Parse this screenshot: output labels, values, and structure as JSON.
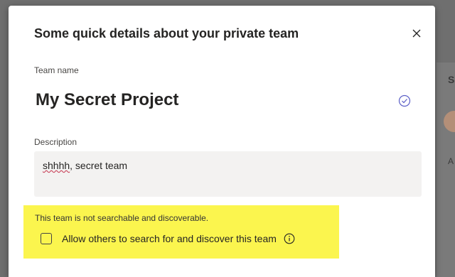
{
  "background": {
    "partial_heading": "S",
    "partial_text": "A"
  },
  "dialog": {
    "title": "Some quick details about your private team",
    "close_icon": "close-icon",
    "team_name_label": "Team name",
    "team_name_value": "My Secret Project",
    "team_name_status_icon": "check-circle-icon",
    "description_label": "Description",
    "description_value_word1": "shhhh",
    "description_value_rest": ", secret team",
    "searchability_note": "This team is not searchable and discoverable.",
    "discover_option": {
      "label": "Allow others to search for and discover this team",
      "checked": false,
      "info_icon": "info-icon"
    }
  },
  "colors": {
    "highlight": "#fbf54e",
    "dialog_bg": "#ffffff",
    "input_bg": "#f3f2f1",
    "overlay": "#6f6f6f"
  }
}
